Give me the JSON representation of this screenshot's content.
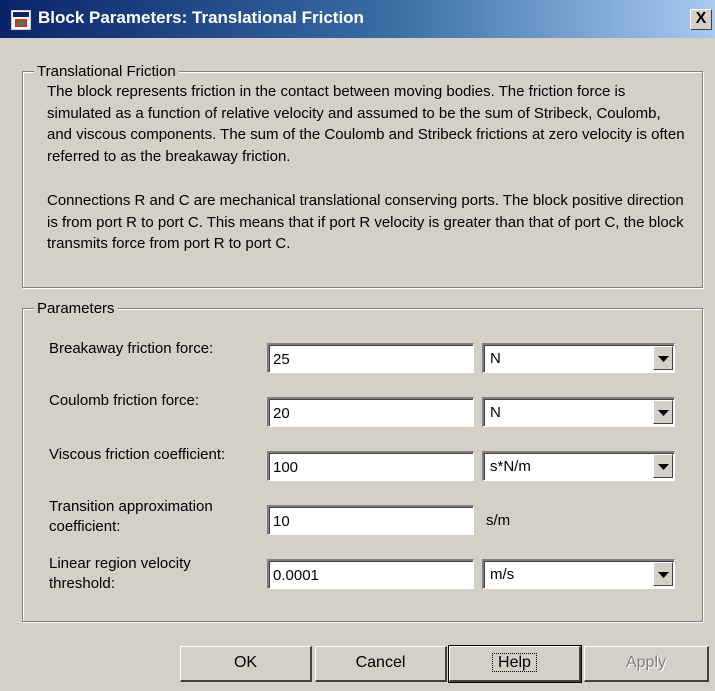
{
  "window": {
    "title": "Block Parameters: Translational Friction",
    "close_label": "X"
  },
  "description_group": {
    "legend": "Translational Friction",
    "paragraph1": "The block represents friction in the contact between moving bodies. The friction force is simulated as a function of relative velocity and assumed to be the sum of Stribeck, Coulomb, and viscous components. The sum of the Coulomb and Stribeck frictions at zero velocity is often referred to as the breakaway friction.",
    "paragraph2": "Connections R and C are mechanical translational conserving ports. The block positive direction is from port R to port C. This means that if port R velocity is greater than that of port C, the block transmits force from port R to port C."
  },
  "parameters": {
    "legend": "Parameters",
    "breakaway": {
      "label": "Breakaway friction force:",
      "value": "25",
      "unit": "N"
    },
    "coulomb": {
      "label": "Coulomb friction force:",
      "value": "20",
      "unit": "N"
    },
    "viscous": {
      "label": "Viscous friction coefficient:",
      "value": "100",
      "unit": "s*N/m"
    },
    "transition": {
      "label_line1": "Transition approximation",
      "label_line2": "coefficient:",
      "value": "10",
      "unit": "s/m"
    },
    "linear": {
      "label_line1": "Linear region velocity",
      "label_line2": "threshold:",
      "value": "0.0001",
      "unit": "m/s"
    }
  },
  "buttons": {
    "ok": "OK",
    "cancel": "Cancel",
    "help": "Help",
    "apply": "Apply"
  },
  "icons": {
    "app": "simulink-block-icon",
    "close": "close-icon",
    "dropdown": "chevron-down-icon"
  }
}
